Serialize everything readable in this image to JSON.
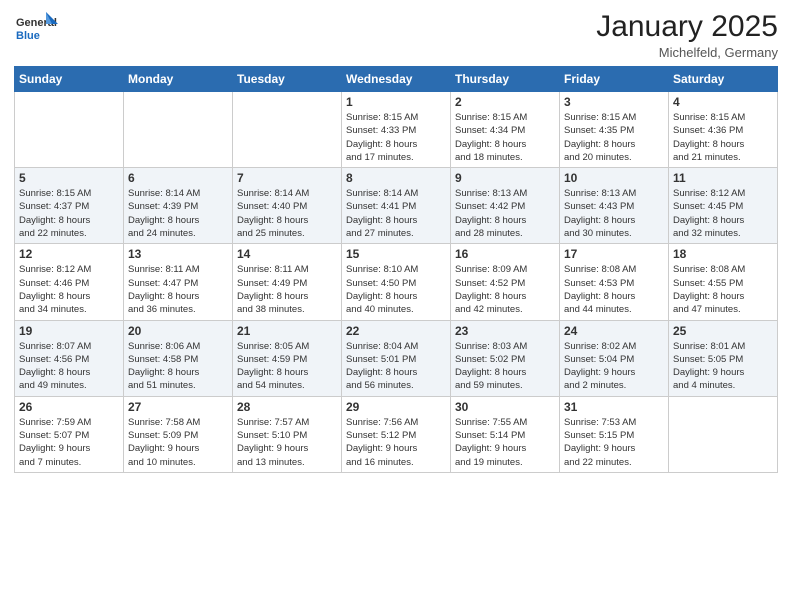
{
  "header": {
    "logo_general": "General",
    "logo_blue": "Blue",
    "month_title": "January 2025",
    "location": "Michelfeld, Germany"
  },
  "days_of_week": [
    "Sunday",
    "Monday",
    "Tuesday",
    "Wednesday",
    "Thursday",
    "Friday",
    "Saturday"
  ],
  "weeks": [
    [
      {
        "day": "",
        "info": ""
      },
      {
        "day": "",
        "info": ""
      },
      {
        "day": "",
        "info": ""
      },
      {
        "day": "1",
        "info": "Sunrise: 8:15 AM\nSunset: 4:33 PM\nDaylight: 8 hours\nand 17 minutes."
      },
      {
        "day": "2",
        "info": "Sunrise: 8:15 AM\nSunset: 4:34 PM\nDaylight: 8 hours\nand 18 minutes."
      },
      {
        "day": "3",
        "info": "Sunrise: 8:15 AM\nSunset: 4:35 PM\nDaylight: 8 hours\nand 20 minutes."
      },
      {
        "day": "4",
        "info": "Sunrise: 8:15 AM\nSunset: 4:36 PM\nDaylight: 8 hours\nand 21 minutes."
      }
    ],
    [
      {
        "day": "5",
        "info": "Sunrise: 8:15 AM\nSunset: 4:37 PM\nDaylight: 8 hours\nand 22 minutes."
      },
      {
        "day": "6",
        "info": "Sunrise: 8:14 AM\nSunset: 4:39 PM\nDaylight: 8 hours\nand 24 minutes."
      },
      {
        "day": "7",
        "info": "Sunrise: 8:14 AM\nSunset: 4:40 PM\nDaylight: 8 hours\nand 25 minutes."
      },
      {
        "day": "8",
        "info": "Sunrise: 8:14 AM\nSunset: 4:41 PM\nDaylight: 8 hours\nand 27 minutes."
      },
      {
        "day": "9",
        "info": "Sunrise: 8:13 AM\nSunset: 4:42 PM\nDaylight: 8 hours\nand 28 minutes."
      },
      {
        "day": "10",
        "info": "Sunrise: 8:13 AM\nSunset: 4:43 PM\nDaylight: 8 hours\nand 30 minutes."
      },
      {
        "day": "11",
        "info": "Sunrise: 8:12 AM\nSunset: 4:45 PM\nDaylight: 8 hours\nand 32 minutes."
      }
    ],
    [
      {
        "day": "12",
        "info": "Sunrise: 8:12 AM\nSunset: 4:46 PM\nDaylight: 8 hours\nand 34 minutes."
      },
      {
        "day": "13",
        "info": "Sunrise: 8:11 AM\nSunset: 4:47 PM\nDaylight: 8 hours\nand 36 minutes."
      },
      {
        "day": "14",
        "info": "Sunrise: 8:11 AM\nSunset: 4:49 PM\nDaylight: 8 hours\nand 38 minutes."
      },
      {
        "day": "15",
        "info": "Sunrise: 8:10 AM\nSunset: 4:50 PM\nDaylight: 8 hours\nand 40 minutes."
      },
      {
        "day": "16",
        "info": "Sunrise: 8:09 AM\nSunset: 4:52 PM\nDaylight: 8 hours\nand 42 minutes."
      },
      {
        "day": "17",
        "info": "Sunrise: 8:08 AM\nSunset: 4:53 PM\nDaylight: 8 hours\nand 44 minutes."
      },
      {
        "day": "18",
        "info": "Sunrise: 8:08 AM\nSunset: 4:55 PM\nDaylight: 8 hours\nand 47 minutes."
      }
    ],
    [
      {
        "day": "19",
        "info": "Sunrise: 8:07 AM\nSunset: 4:56 PM\nDaylight: 8 hours\nand 49 minutes."
      },
      {
        "day": "20",
        "info": "Sunrise: 8:06 AM\nSunset: 4:58 PM\nDaylight: 8 hours\nand 51 minutes."
      },
      {
        "day": "21",
        "info": "Sunrise: 8:05 AM\nSunset: 4:59 PM\nDaylight: 8 hours\nand 54 minutes."
      },
      {
        "day": "22",
        "info": "Sunrise: 8:04 AM\nSunset: 5:01 PM\nDaylight: 8 hours\nand 56 minutes."
      },
      {
        "day": "23",
        "info": "Sunrise: 8:03 AM\nSunset: 5:02 PM\nDaylight: 8 hours\nand 59 minutes."
      },
      {
        "day": "24",
        "info": "Sunrise: 8:02 AM\nSunset: 5:04 PM\nDaylight: 9 hours\nand 2 minutes."
      },
      {
        "day": "25",
        "info": "Sunrise: 8:01 AM\nSunset: 5:05 PM\nDaylight: 9 hours\nand 4 minutes."
      }
    ],
    [
      {
        "day": "26",
        "info": "Sunrise: 7:59 AM\nSunset: 5:07 PM\nDaylight: 9 hours\nand 7 minutes."
      },
      {
        "day": "27",
        "info": "Sunrise: 7:58 AM\nSunset: 5:09 PM\nDaylight: 9 hours\nand 10 minutes."
      },
      {
        "day": "28",
        "info": "Sunrise: 7:57 AM\nSunset: 5:10 PM\nDaylight: 9 hours\nand 13 minutes."
      },
      {
        "day": "29",
        "info": "Sunrise: 7:56 AM\nSunset: 5:12 PM\nDaylight: 9 hours\nand 16 minutes."
      },
      {
        "day": "30",
        "info": "Sunrise: 7:55 AM\nSunset: 5:14 PM\nDaylight: 9 hours\nand 19 minutes."
      },
      {
        "day": "31",
        "info": "Sunrise: 7:53 AM\nSunset: 5:15 PM\nDaylight: 9 hours\nand 22 minutes."
      },
      {
        "day": "",
        "info": ""
      }
    ]
  ]
}
